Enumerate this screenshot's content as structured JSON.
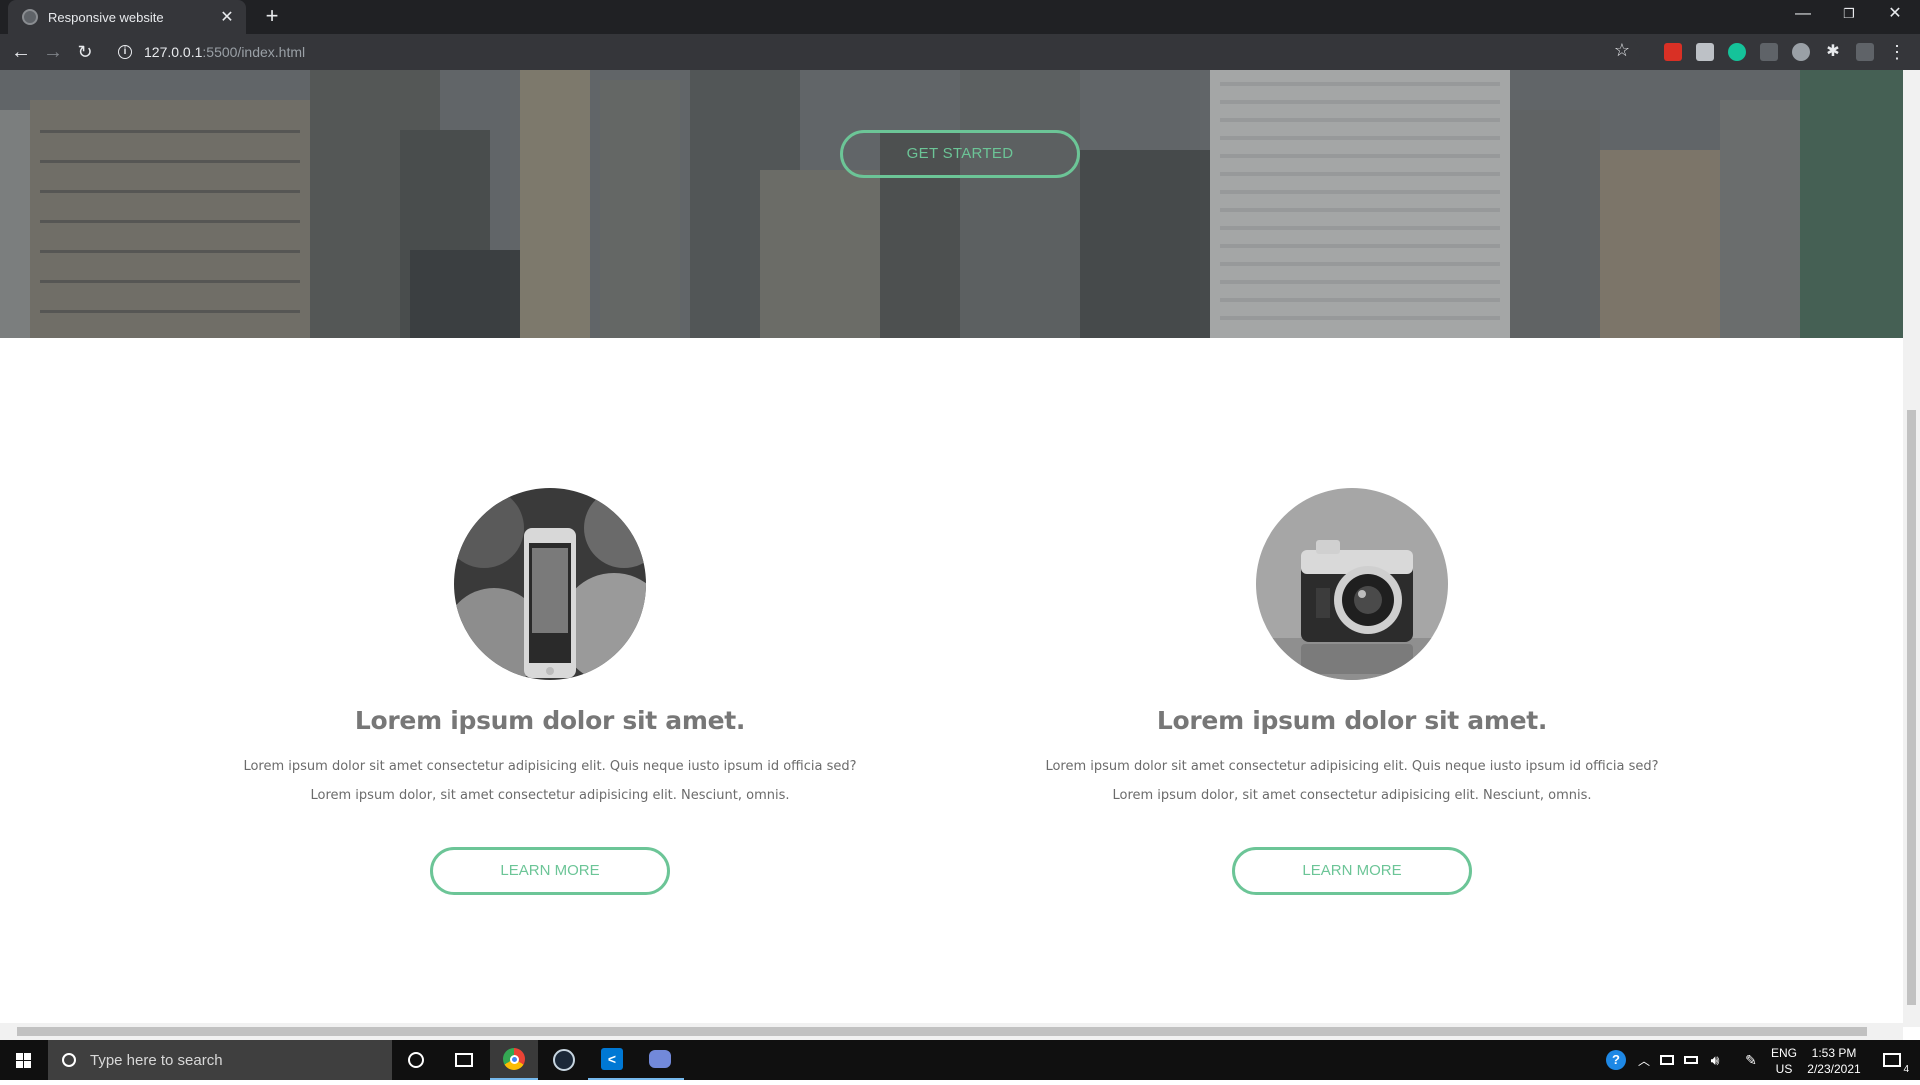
{
  "browser": {
    "tab_title": "Responsive website",
    "url_host": "127.0.0.1",
    "url_path": ":5500/index.html"
  },
  "hero": {
    "cta_label": "GET STARTED"
  },
  "features": [
    {
      "image": "phone-photo",
      "title": "Lorem ipsum dolor sit amet.",
      "text1": "Lorem ipsum dolor sit amet consectetur adipisicing elit. Quis neque iusto ipsum id officia sed?",
      "text2": "Lorem ipsum dolor, sit amet consectetur adipisicing elit. Nesciunt, omnis.",
      "button": "LEARN MORE"
    },
    {
      "image": "camera-photo",
      "title": "Lorem ipsum dolor sit amet.",
      "text1": "Lorem ipsum dolor sit amet consectetur adipisicing elit. Quis neque iusto ipsum id officia sed?",
      "text2": "Lorem ipsum dolor, sit amet consectetur adipisicing elit. Nesciunt, omnis.",
      "button": "LEARN MORE"
    }
  ],
  "taskbar": {
    "search_placeholder": "Type here to search",
    "lang_1": "ENG",
    "lang_2": "US",
    "time": "1:53 PM",
    "date": "2/23/2021",
    "notification_count": "4"
  },
  "colors": {
    "accent": "#6cc597",
    "text_gray": "#777777"
  }
}
